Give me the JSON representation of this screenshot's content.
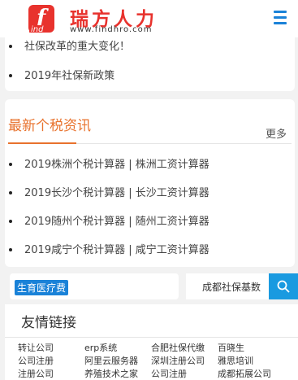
{
  "header": {
    "logo_letter": "f",
    "logo_subtext": "ind",
    "title": "瑞方人力",
    "url": "www.findhro.com"
  },
  "top_news": [
    {
      "text": "社保改革的重大变化！"
    },
    {
      "text": "2019年社保新政策"
    }
  ],
  "tax_section": {
    "title": "最新个税资讯",
    "more": "更多",
    "items": [
      {
        "text": "2019株洲个税计算器 | 株洲工资计算器"
      },
      {
        "text": "2019长沙个税计算器 | 长沙工资计算器"
      },
      {
        "text": "2019随州个税计算器 | 随州工资计算器"
      },
      {
        "text": "2019咸宁个税计算器 | 咸宁工资计算器"
      }
    ]
  },
  "tag": {
    "label": "生育医疗费"
  },
  "search": {
    "value": "成都社保基数"
  },
  "friend_links": {
    "title": "友情链接",
    "links": [
      "转让公司",
      "erp系统",
      "合肥社保代缴",
      "百晓生",
      "公司注册",
      "阿里云服务器",
      "深圳注册公司",
      "雅思培训",
      "注册公司",
      "养殖技术之家",
      "公司注册",
      "成都拓展公司"
    ]
  },
  "colors": {
    "brand_red": "#e8322d",
    "accent_orange": "#e8722d",
    "accent_blue": "#1a82d8"
  },
  "icons": {
    "menu": "hamburger-menu-icon",
    "search": "search-icon",
    "bullet": "bullet-dot-icon"
  }
}
